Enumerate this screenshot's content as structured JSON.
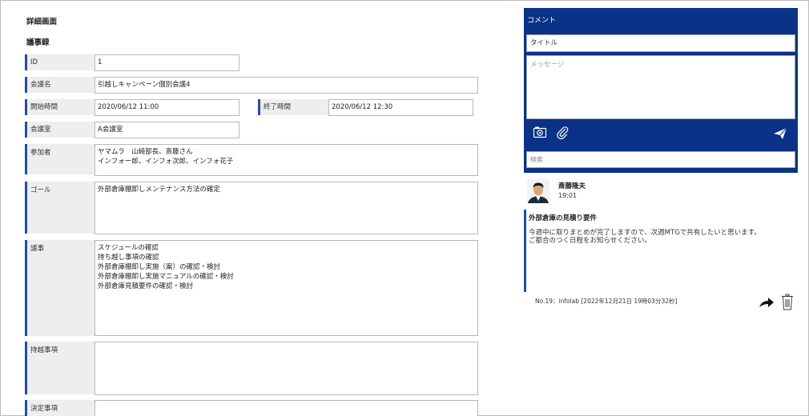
{
  "page": {
    "title": "詳細画面",
    "section": "議事録"
  },
  "form": {
    "id": {
      "label": "ID",
      "value": "1"
    },
    "meeting_name": {
      "label": "会議名",
      "value": "引越しキャンペーン個別会議4"
    },
    "start": {
      "label": "開始時間",
      "value": "2020/06/12 11:00"
    },
    "end": {
      "label": "終了時間",
      "value": "2020/06/12 12:30"
    },
    "room": {
      "label": "会議室",
      "value": "A会議室"
    },
    "participants": {
      "label": "参加者",
      "lines": [
        "ヤマムラ　山崎部長、斎藤さん",
        "インフォー郎、インフォ次郎、インフォ花子"
      ]
    },
    "goal": {
      "label": "ゴール",
      "lines": [
        "外部倉庫棚卸しメンテナンス方法の確定"
      ]
    },
    "agenda": {
      "label": "議事",
      "lines": [
        "スケジュールの確認",
        "持ち越し事項の確認",
        "外部倉庫棚卸し実施（案）の確認・検討",
        "外部倉庫棚卸し実施マニュアルの確認・検討",
        "外部倉庫見積要件の確認・検討"
      ]
    },
    "carryover": {
      "label": "持越事項",
      "lines": []
    },
    "decisions": {
      "label": "決定事項",
      "lines": []
    }
  },
  "comment_panel": {
    "title": "コメント",
    "title_input": "タイトル",
    "message_placeholder": "メッセージ",
    "search_placeholder": "検索",
    "icons": {
      "camera": "camera-icon",
      "attach": "paperclip-icon",
      "send": "send-icon"
    }
  },
  "comment": {
    "author": "斎藤隆夫",
    "time": "19:01",
    "heading": "外部倉庫の見積り要件",
    "lines": [
      "今週中に取りまとめが完了しますので、次週MTGで共有したいと思います。",
      "ご都合のつく日程をお知らせください。"
    ],
    "meta": "No.19：infolab [2022年12月21日 19時03分32秒]",
    "icons": {
      "share": "share-icon",
      "delete": "trash-icon"
    }
  },
  "colors": {
    "accent": "#1f4ea8",
    "panel": "#0a3286",
    "label_bg": "#eeeeee"
  }
}
